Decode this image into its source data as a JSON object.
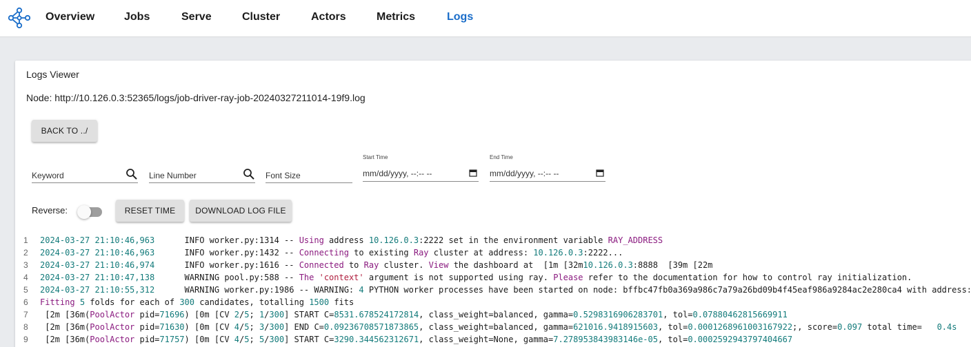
{
  "nav": {
    "items": [
      "Overview",
      "Jobs",
      "Serve",
      "Cluster",
      "Actors",
      "Metrics",
      "Logs"
    ],
    "active": "Logs"
  },
  "viewer": {
    "title": "Logs Viewer",
    "node": "Node: http://10.126.0.3:52365/logs/job-driver-ray-job-20240327211014-19f9.log",
    "back_label": "BACK TO ../",
    "keyword_placeholder": "Keyword",
    "line_number_placeholder": "Line Number",
    "font_size_placeholder": "Font Size",
    "start_time_label": "Start Time",
    "end_time_label": "End Time",
    "start_time_value": "mm/dd/yyyy, --:-- --",
    "end_time_value": "mm/dd/yyyy, --:-- --",
    "reverse_label": "Reverse:",
    "reverse_on": false,
    "reset_time_label": "RESET TIME",
    "download_label": "DOWNLOAD LOG FILE"
  },
  "logs": [
    {
      "n": "1",
      "parts": [
        [
          "ts",
          "2024-03-27 21:10:46,963"
        ],
        [
          "txt",
          "      INFO worker.py:1314 -- "
        ],
        [
          "kw",
          "Using"
        ],
        [
          "txt",
          " address "
        ],
        [
          "num",
          "10.126.0.3"
        ],
        [
          "txt",
          ":2222 set in the environment variable "
        ],
        [
          "kw",
          "RAY_ADDRESS"
        ]
      ]
    },
    {
      "n": "2",
      "parts": [
        [
          "ts",
          "2024-03-27 21:10:46,963"
        ],
        [
          "txt",
          "      INFO worker.py:1432 -- "
        ],
        [
          "kw",
          "Connecting"
        ],
        [
          "txt",
          " to existing "
        ],
        [
          "kw",
          "Ray"
        ],
        [
          "txt",
          " cluster at address: "
        ],
        [
          "num",
          "10.126.0.3"
        ],
        [
          "txt",
          ":2222..."
        ]
      ]
    },
    {
      "n": "3",
      "parts": [
        [
          "ts",
          "2024-03-27 21:10:46,974"
        ],
        [
          "txt",
          "      INFO worker.py:1616 -- "
        ],
        [
          "kw",
          "Connected"
        ],
        [
          "txt",
          " to "
        ],
        [
          "kw",
          "Ray"
        ],
        [
          "txt",
          " cluster. "
        ],
        [
          "kw",
          "View"
        ],
        [
          "txt",
          " the dashboard at  [1m [32m"
        ],
        [
          "num",
          "10.126.0.3"
        ],
        [
          "txt",
          ":8888  [39m [22m"
        ]
      ]
    },
    {
      "n": "4",
      "parts": [
        [
          "ts",
          "2024-03-27 21:10:47,138"
        ],
        [
          "txt",
          "      WARNING pool.py:588 -- "
        ],
        [
          "kw",
          "The"
        ],
        [
          "txt",
          " "
        ],
        [
          "str",
          "'context'"
        ],
        [
          "txt",
          " argument is not supported using ray. "
        ],
        [
          "kw",
          "Please"
        ],
        [
          "txt",
          " refer to the documentation for how to control ray initialization."
        ]
      ]
    },
    {
      "n": "5",
      "parts": [
        [
          "ts",
          "2024-03-27 21:10:55,312"
        ],
        [
          "txt",
          "      WARNING worker.py:1986 -- WARNING: "
        ],
        [
          "num",
          "4"
        ],
        [
          "txt",
          " PYTHON worker processes have been started on node: bffbc47fb0a369a986c7a79a26bd09b4f45eaf986a9284ac2e280ca4 with address: "
        ]
      ]
    },
    {
      "n": "6",
      "parts": [
        [
          "kw",
          "Fitting"
        ],
        [
          "txt",
          " "
        ],
        [
          "num",
          "5"
        ],
        [
          "txt",
          " folds for each of "
        ],
        [
          "num",
          "300"
        ],
        [
          "txt",
          " candidates, totalling "
        ],
        [
          "num",
          "1500"
        ],
        [
          "txt",
          " fits"
        ]
      ]
    },
    {
      "n": "7",
      "parts": [
        [
          "txt",
          " [2m [36m("
        ],
        [
          "kw",
          "PoolActor"
        ],
        [
          "txt",
          " pid="
        ],
        [
          "num",
          "71696"
        ],
        [
          "txt",
          ") [0m [CV "
        ],
        [
          "num",
          "2"
        ],
        [
          "txt",
          "/"
        ],
        [
          "num",
          "5"
        ],
        [
          "txt",
          "; "
        ],
        [
          "num",
          "1"
        ],
        [
          "txt",
          "/"
        ],
        [
          "num",
          "300"
        ],
        [
          "txt",
          "] START C="
        ],
        [
          "num",
          "8531.678524172814"
        ],
        [
          "txt",
          ", class_weight=balanced, gamma="
        ],
        [
          "num",
          "0.5298316906283701"
        ],
        [
          "txt",
          ", tol="
        ],
        [
          "num",
          "0.07880462815669911"
        ]
      ]
    },
    {
      "n": "8",
      "parts": [
        [
          "txt",
          " [2m [36m("
        ],
        [
          "kw",
          "PoolActor"
        ],
        [
          "txt",
          " pid="
        ],
        [
          "num",
          "71630"
        ],
        [
          "txt",
          ") [0m [CV "
        ],
        [
          "num",
          "4"
        ],
        [
          "txt",
          "/"
        ],
        [
          "num",
          "5"
        ],
        [
          "txt",
          "; "
        ],
        [
          "num",
          "3"
        ],
        [
          "txt",
          "/"
        ],
        [
          "num",
          "300"
        ],
        [
          "txt",
          "] END C="
        ],
        [
          "num",
          "0.09236708571873865"
        ],
        [
          "txt",
          ", class_weight=balanced, gamma="
        ],
        [
          "num",
          "621016.9418915603"
        ],
        [
          "txt",
          ", tol="
        ],
        [
          "num",
          "0.0001268961003167922"
        ],
        [
          "txt",
          ";, score="
        ],
        [
          "num",
          "0.097"
        ],
        [
          "txt",
          " total time=   "
        ],
        [
          "num",
          "0.4s"
        ]
      ]
    },
    {
      "n": "9",
      "parts": [
        [
          "txt",
          " [2m [36m("
        ],
        [
          "kw",
          "PoolActor"
        ],
        [
          "txt",
          " pid="
        ],
        [
          "num",
          "71757"
        ],
        [
          "txt",
          ") [0m [CV "
        ],
        [
          "num",
          "4"
        ],
        [
          "txt",
          "/"
        ],
        [
          "num",
          "5"
        ],
        [
          "txt",
          "; "
        ],
        [
          "num",
          "5"
        ],
        [
          "txt",
          "/"
        ],
        [
          "num",
          "300"
        ],
        [
          "txt",
          "] START C="
        ],
        [
          "num",
          "3290.344562312671"
        ],
        [
          "txt",
          ", class_weight=None, gamma="
        ],
        [
          "num",
          "7.278953843983146e-05"
        ],
        [
          "txt",
          ", tol="
        ],
        [
          "num",
          "0.0002592943797404667"
        ]
      ]
    }
  ]
}
